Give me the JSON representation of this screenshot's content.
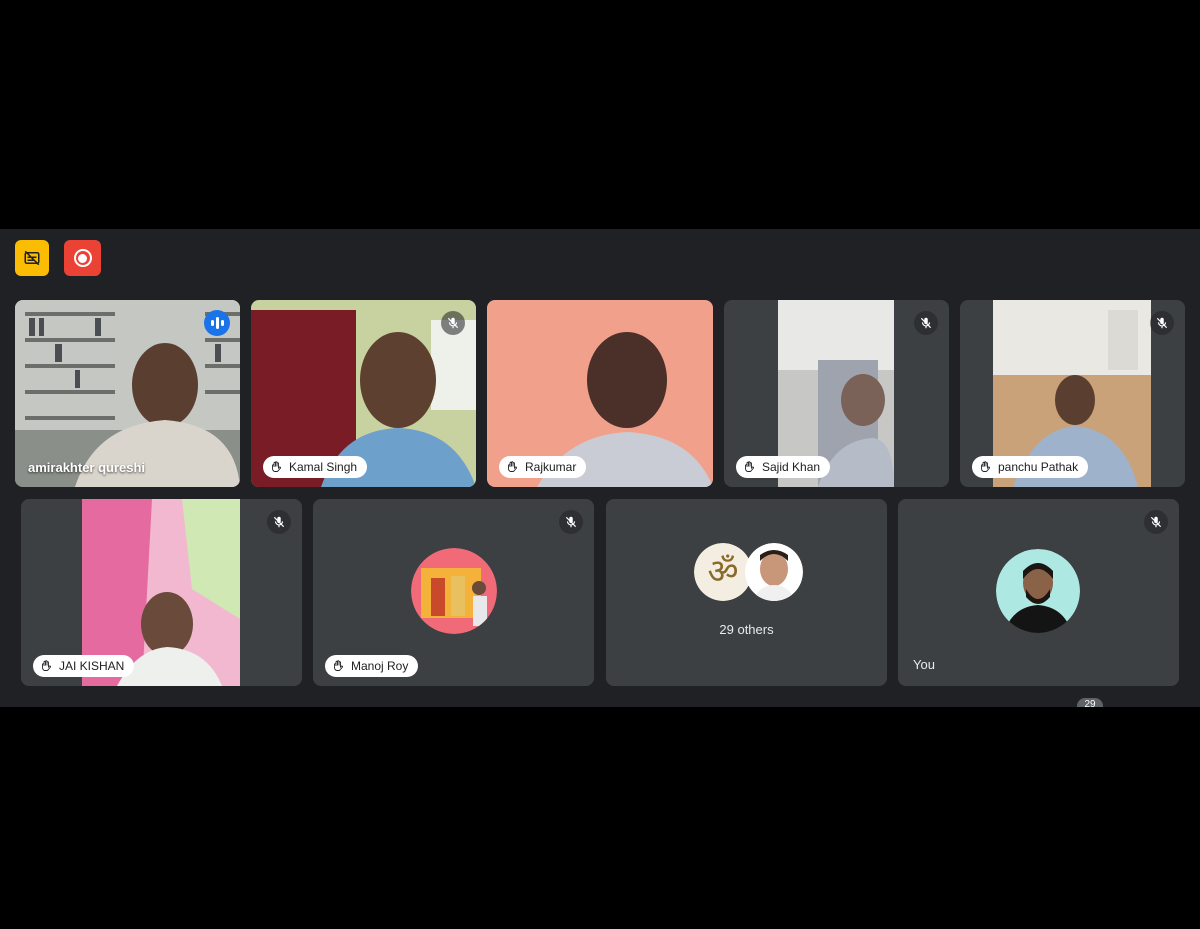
{
  "toolbar": {
    "captions_icon": "captions-off-icon",
    "record_icon": "recording-icon",
    "captions_color": "#fbbc04",
    "record_color": "#ea4335"
  },
  "participants": [
    {
      "name": "amirakhter qureshi",
      "status": "speaking"
    },
    {
      "name": "Kamal Singh",
      "status": "muted"
    },
    {
      "name": "Rajkumar",
      "status": "hand-raised"
    },
    {
      "name": "Sajid Khan",
      "status": "muted"
    },
    {
      "name": "panchu Pathak",
      "status": "muted"
    },
    {
      "name": "JAI KISHAN",
      "status": "muted"
    },
    {
      "name": "Manoj Roy",
      "status": "muted"
    }
  ],
  "others": {
    "label": "29 others"
  },
  "self": {
    "label": "You"
  },
  "overflow_badge": "29",
  "colors": {
    "background": "#202124",
    "tile": "#3c4043",
    "speaking_border": "#8ab4f8"
  }
}
